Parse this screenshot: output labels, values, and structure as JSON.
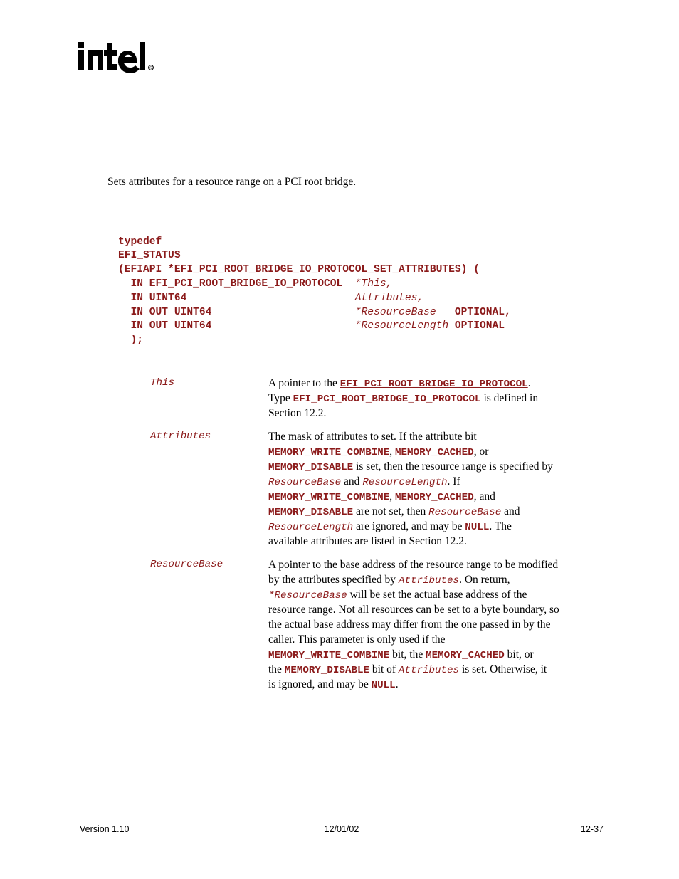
{
  "logo": {
    "wordmark": "intel",
    "trademark": "®"
  },
  "intro": "Sets attributes for a resource range on a PCI root bridge.",
  "code": {
    "lines": [
      "typedef",
      "EFI_STATUS",
      "(EFIAPI *EFI_PCI_ROOT_BRIDGE_IO_PROTOCOL_SET_ATTRIBUTES) (",
      "  IN EFI_PCI_ROOT_BRIDGE_IO_PROTOCOL  *This,",
      "  IN UINT64                           Attributes,",
      "  IN OUT UINT64                       *ResourceBase   OPTIONAL,",
      "  IN OUT UINT64                       *ResourceLength OPTIONAL",
      "  );"
    ],
    "line1_keyword": "typedef",
    "line2_keyword": "EFI_STATUS",
    "line3_open": "(EFIAPI *EFI_PCI_ROOT_BRIDGE_IO_PROTOCOL_SET_ATTRIBUTES) (",
    "line4_type": "  IN EFI_PCI_ROOT_BRIDGE_IO_PROTOCOL  ",
    "line4_param": "*This,",
    "line5_type": "  IN UINT64                           ",
    "line5_param": "Attributes,",
    "line6_type": "  IN OUT UINT64                       ",
    "line6_param": "*ResourceBase   ",
    "line6_optional": "OPTIONAL,",
    "line7_type": "  IN OUT UINT64                       ",
    "line7_param": "*ResourceLength ",
    "line7_optional": "OPTIONAL",
    "line8_close": "  );"
  },
  "parameters": [
    {
      "name": "This",
      "lines": [
        {
          "segments": [
            {
              "text": "A pointer to the ",
              "style": "plain"
            },
            {
              "text": "EFI_PCI_ROOT_BRIDGE_IO_PROTOCOL",
              "style": "link"
            },
            {
              "text": ".",
              "style": "plain"
            }
          ]
        },
        {
          "segments": [
            {
              "text": "Type ",
              "style": "plain"
            },
            {
              "text": "EFI_PCI_ROOT_BRIDGE_IO_PROTOCOL",
              "style": "bold"
            },
            {
              "text": " is defined in",
              "style": "plain"
            }
          ]
        },
        {
          "segments": [
            {
              "text": "Section 12.2.",
              "style": "plain"
            }
          ]
        }
      ]
    },
    {
      "name": "Attributes",
      "lines": [
        {
          "segments": [
            {
              "text": "The mask of attributes to set.  If the attribute bit",
              "style": "plain"
            }
          ]
        },
        {
          "segments": [
            {
              "text": "MEMORY_WRITE_COMBINE",
              "style": "bold"
            },
            {
              "text": ", ",
              "style": "plain"
            },
            {
              "text": "MEMORY_CACHED",
              "style": "bold"
            },
            {
              "text": ", or",
              "style": "plain"
            }
          ]
        },
        {
          "segments": [
            {
              "text": "MEMORY_DISABLE",
              "style": "bold"
            },
            {
              "text": " is set, then the resource range is specified by",
              "style": "plain"
            }
          ]
        },
        {
          "segments": [
            {
              "text": "ResourceBase",
              "style": "ital"
            },
            {
              "text": " and ",
              "style": "plain"
            },
            {
              "text": "ResourceLength",
              "style": "ital"
            },
            {
              "text": ".  If",
              "style": "plain"
            }
          ]
        },
        {
          "segments": [
            {
              "text": "MEMORY_WRITE_COMBINE",
              "style": "bold"
            },
            {
              "text": ", ",
              "style": "plain"
            },
            {
              "text": "MEMORY_CACHED",
              "style": "bold"
            },
            {
              "text": ", and",
              "style": "plain"
            }
          ]
        },
        {
          "segments": [
            {
              "text": "MEMORY_DISABLE",
              "style": "bold"
            },
            {
              "text": "  are not set, then ",
              "style": "plain"
            },
            {
              "text": "ResourceBase",
              "style": "ital"
            },
            {
              "text": " and",
              "style": "plain"
            }
          ]
        },
        {
          "segments": [
            {
              "text": "ResourceLength",
              "style": "ital"
            },
            {
              "text": " are ignored, and may be ",
              "style": "plain"
            },
            {
              "text": "NULL",
              "style": "bold"
            },
            {
              "text": ".  The",
              "style": "plain"
            }
          ]
        },
        {
          "segments": [
            {
              "text": "available attributes are listed in Section 12.2.",
              "style": "plain"
            }
          ]
        }
      ]
    },
    {
      "name": "ResourceBase",
      "lines": [
        {
          "segments": [
            {
              "text": "A pointer to the base address of the resource range to be modified",
              "style": "plain"
            }
          ]
        },
        {
          "segments": [
            {
              "text": "by the attributes specified by ",
              "style": "plain"
            },
            {
              "text": "Attributes",
              "style": "ital"
            },
            {
              "text": ".  On return,",
              "style": "plain"
            }
          ]
        },
        {
          "segments": [
            {
              "text": "*ResourceBase",
              "style": "ital"
            },
            {
              "text": " will be set the actual base address of the",
              "style": "plain"
            }
          ]
        },
        {
          "segments": [
            {
              "text": "resource range.  Not all resources can be set to a byte boundary, so",
              "style": "plain"
            }
          ]
        },
        {
          "segments": [
            {
              "text": "the actual base address may differ from the one passed in by the",
              "style": "plain"
            }
          ]
        },
        {
          "segments": [
            {
              "text": "caller.  This parameter is only used if the",
              "style": "plain"
            }
          ]
        },
        {
          "segments": [
            {
              "text": "MEMORY_WRITE_COMBINE",
              "style": "bold"
            },
            {
              "text": " bit, the ",
              "style": "plain"
            },
            {
              "text": "MEMORY_CACHED",
              "style": "bold"
            },
            {
              "text": " bit, or",
              "style": "plain"
            }
          ]
        },
        {
          "segments": [
            {
              "text": "the ",
              "style": "plain"
            },
            {
              "text": "MEMORY_DISABLE",
              "style": "bold"
            },
            {
              "text": " bit of ",
              "style": "plain"
            },
            {
              "text": "Attributes",
              "style": "ital"
            },
            {
              "text": " is set.  Otherwise, it",
              "style": "plain"
            }
          ]
        },
        {
          "segments": [
            {
              "text": "is ignored, and may be ",
              "style": "plain"
            },
            {
              "text": "NULL",
              "style": "bold"
            },
            {
              "text": ".",
              "style": "plain"
            }
          ]
        }
      ]
    }
  ],
  "footer": {
    "left": "Version 1.10",
    "center": "12/01/02",
    "right": "12-37"
  },
  "colors": {
    "code_red": "#8B1A1A",
    "body_black": "#000000",
    "page_background": "#FFFFFF"
  }
}
